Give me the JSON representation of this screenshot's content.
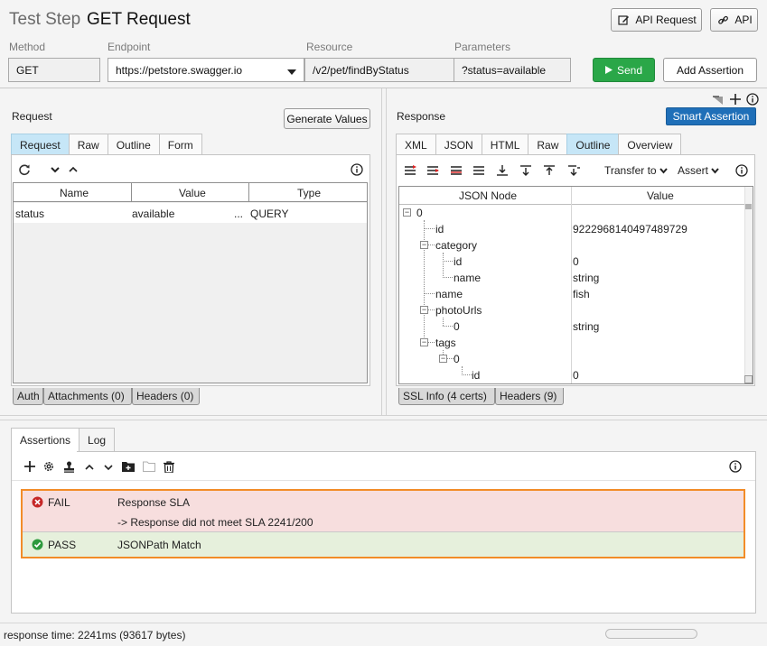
{
  "header": {
    "prefix": "Test Step",
    "title": "GET Request",
    "api_request_label": "API Request",
    "api_label": "API"
  },
  "request_bar": {
    "method_label": "Method",
    "method_value": "GET",
    "endpoint_label": "Endpoint",
    "endpoint_value": "https://petstore.swagger.io",
    "resource_label": "Resource",
    "resource_value": "/v2/pet/findByStatus",
    "parameters_label": "Parameters",
    "parameters_value": "?status=available",
    "send_label": "Send",
    "add_assertion_label": "Add Assertion"
  },
  "request_panel": {
    "title": "Request",
    "generate_values_label": "Generate Values",
    "tabs": [
      "Request",
      "Raw",
      "Outline",
      "Form"
    ],
    "active_tab": "Request",
    "columns": [
      "Name",
      "Value",
      "Type"
    ],
    "rows": [
      {
        "name": "status",
        "value": "available",
        "ellipsis": "...",
        "type": "QUERY"
      }
    ],
    "bottom_tabs": [
      "Auth",
      "Attachments (0)",
      "Headers (0)"
    ]
  },
  "response_panel": {
    "title": "Response",
    "smart_assertion_label": "Smart Assertion",
    "tabs": [
      "XML",
      "JSON",
      "HTML",
      "Raw",
      "Outline",
      "Overview"
    ],
    "active_tab": "Outline",
    "transfer_label": "Transfer to",
    "assert_label": "Assert",
    "columns": [
      "JSON Node",
      "Value"
    ],
    "nodes": [
      {
        "label": "0",
        "value": ""
      },
      {
        "label": "id",
        "value": "9222968140497489729"
      },
      {
        "label": "category",
        "value": ""
      },
      {
        "label": "id",
        "value": "0"
      },
      {
        "label": "name",
        "value": "string"
      },
      {
        "label": "name",
        "value": "fish"
      },
      {
        "label": "photoUrls",
        "value": ""
      },
      {
        "label": "0",
        "value": "string"
      },
      {
        "label": "tags",
        "value": ""
      },
      {
        "label": "0",
        "value": ""
      },
      {
        "label": "id",
        "value": "0"
      }
    ],
    "bottom_tabs": [
      "SSL Info (4 certs)",
      "Headers (9)"
    ]
  },
  "assertions": {
    "tabs": [
      "Assertions",
      "Log"
    ],
    "active_tab": "Assertions",
    "items": [
      {
        "status": "FAIL",
        "name": "Response SLA",
        "detail": "-> Response did not meet SLA 2241/200"
      },
      {
        "status": "PASS",
        "name": "JSONPath Match",
        "detail": ""
      }
    ]
  },
  "status_bar": {
    "text": "response time: 2241ms (93617 bytes)"
  },
  "colors": {
    "send_green": "#2aa748",
    "smart_blue": "#1f6fb8",
    "active_tab": "#c6e6f7",
    "fail_bg": "#f7dede",
    "pass_bg": "#e6f0dc",
    "highlight_orange": "#f28c28"
  }
}
